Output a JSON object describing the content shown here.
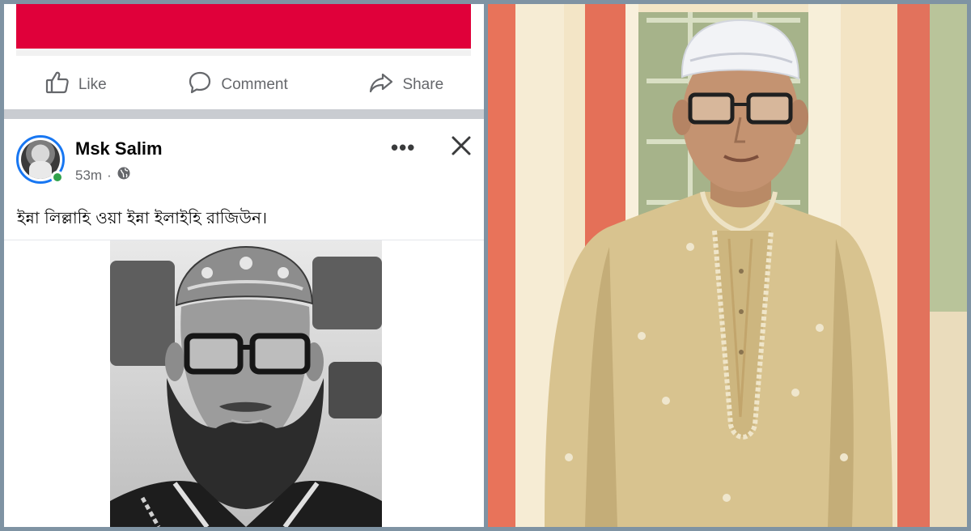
{
  "post_card": {
    "actions": {
      "like_label": "Like",
      "comment_label": "Comment",
      "share_label": "Share"
    },
    "author": "Msk Salim",
    "time": "53m",
    "separator": "·",
    "body_text": "ইন্না লিল্লাহি ওয়া ইন্না ইলাইহি রাজিউন।",
    "more_label": "•••"
  },
  "colors": {
    "banner": "#e0003a",
    "action_text": "#65676b",
    "accent": "#1877f2",
    "online": "#31a24c"
  },
  "icons": {
    "like": "thumbs-up-icon",
    "comment": "speech-bubble-icon",
    "share": "share-arrow-icon",
    "privacy": "globe-icon",
    "more": "ellipsis-icon",
    "close": "close-icon"
  }
}
